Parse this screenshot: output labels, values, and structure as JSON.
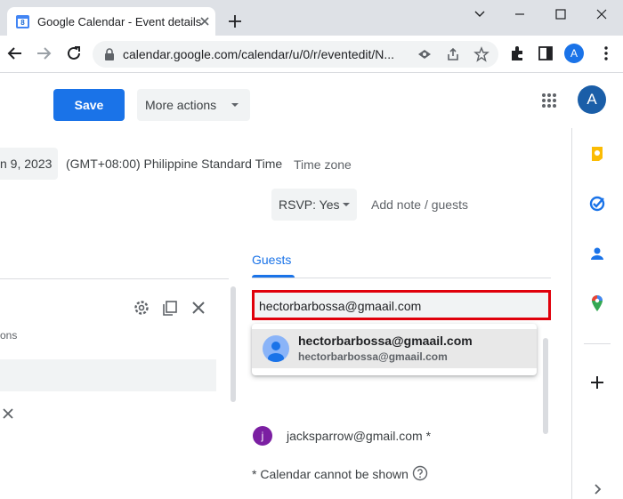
{
  "browser": {
    "tab_title": "Google Calendar - Event details",
    "favicon_text": "8",
    "url": "calendar.google.com/calendar/u/0/r/eventedit/N...",
    "profile_initial": "A"
  },
  "header": {
    "save_label": "Save",
    "more_actions_label": "More actions",
    "avatar_initial": "A"
  },
  "event": {
    "date_partial": "n 9, 2023",
    "timezone": "(GMT+08:00) Philippine Standard Time",
    "timezone_link": "Time zone",
    "rsvp_label": "RSVP: Yes",
    "add_note_label": "Add note / guests"
  },
  "guests": {
    "tab_label": "Guests",
    "input_value": "hectorbarbossa@gmaail.com",
    "suggestion": {
      "name": "hectorbarbossa@gmaail.com",
      "email": "hectorbarbossa@gmaail.com"
    },
    "list": [
      {
        "initial": "j",
        "email": "jacksparrow@gmail.com *",
        "color": "#7b1fa2"
      }
    ],
    "calendar_note": "* Calendar cannot be shown"
  },
  "left_panel": {
    "subtitle_partial": "ons"
  },
  "colors": {
    "accent": "#1a73e8",
    "highlight_border": "#e0000b"
  }
}
